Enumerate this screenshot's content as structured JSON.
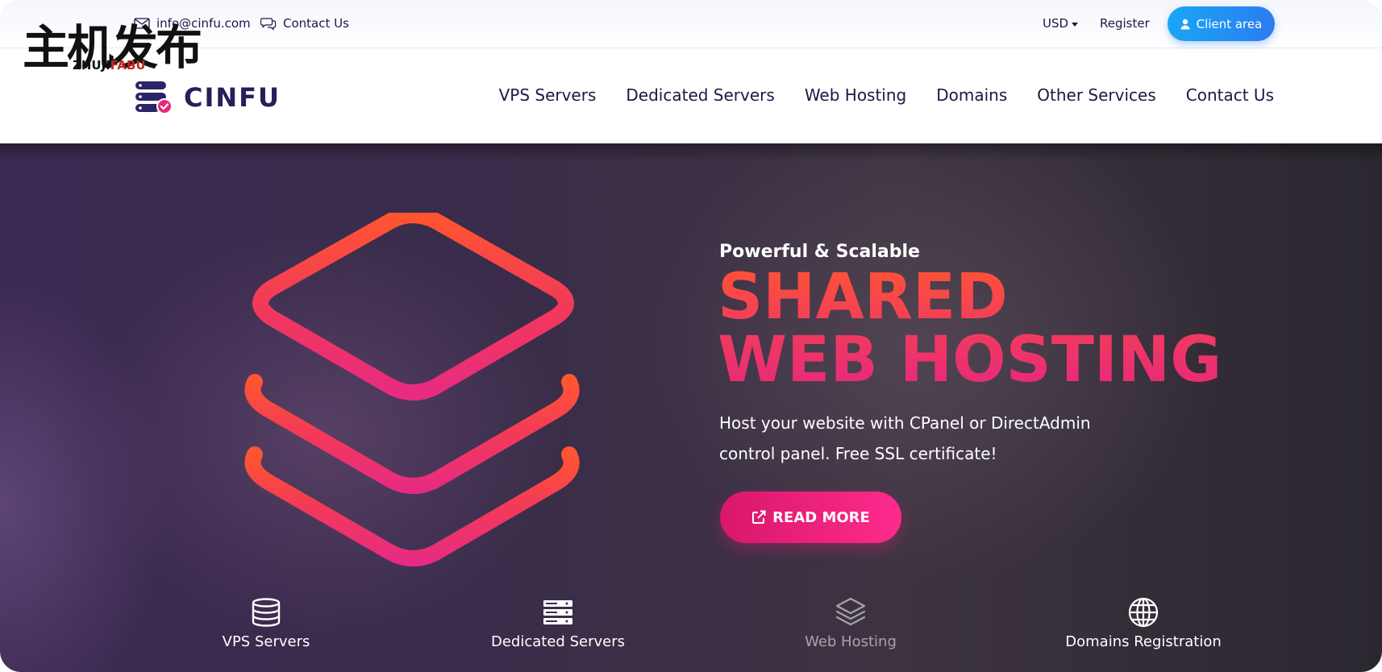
{
  "watermark": {
    "main": "主机发布",
    "sub_a": "ZHUJI",
    "sub_b": "FABU"
  },
  "topbar": {
    "email": "info@cinfu.com",
    "contact": "Contact Us",
    "currency": "USD",
    "register": "Register",
    "client_area": "Client area"
  },
  "brand": {
    "name": "CINFU"
  },
  "nav": {
    "items": [
      {
        "label": "VPS Servers"
      },
      {
        "label": "Dedicated Servers"
      },
      {
        "label": "Web Hosting"
      },
      {
        "label": "Domains"
      },
      {
        "label": "Other Services"
      },
      {
        "label": "Contact Us"
      }
    ]
  },
  "hero": {
    "eyebrow": "Powerful & Scalable",
    "title_line1": "SHARED",
    "title_line2": "WEB HOSTING",
    "description": "Host your website with CPanel or DirectAdmin control panel. Free SSL certificate!",
    "cta": "READ MORE",
    "icon": "layers-icon"
  },
  "features": [
    {
      "label": "VPS Servers",
      "icon": "database-icon",
      "active": false
    },
    {
      "label": "Dedicated Servers",
      "icon": "server-icon",
      "active": false
    },
    {
      "label": "Web Hosting",
      "icon": "layers-icon",
      "active": true
    },
    {
      "label": "Domains Registration",
      "icon": "globe-icon",
      "active": false
    }
  ],
  "colors": {
    "accent_blue": "#1aa6f5",
    "accent_pink": "#e8287a",
    "accent_orange": "#ff5236",
    "nav_text": "#1d1846"
  }
}
